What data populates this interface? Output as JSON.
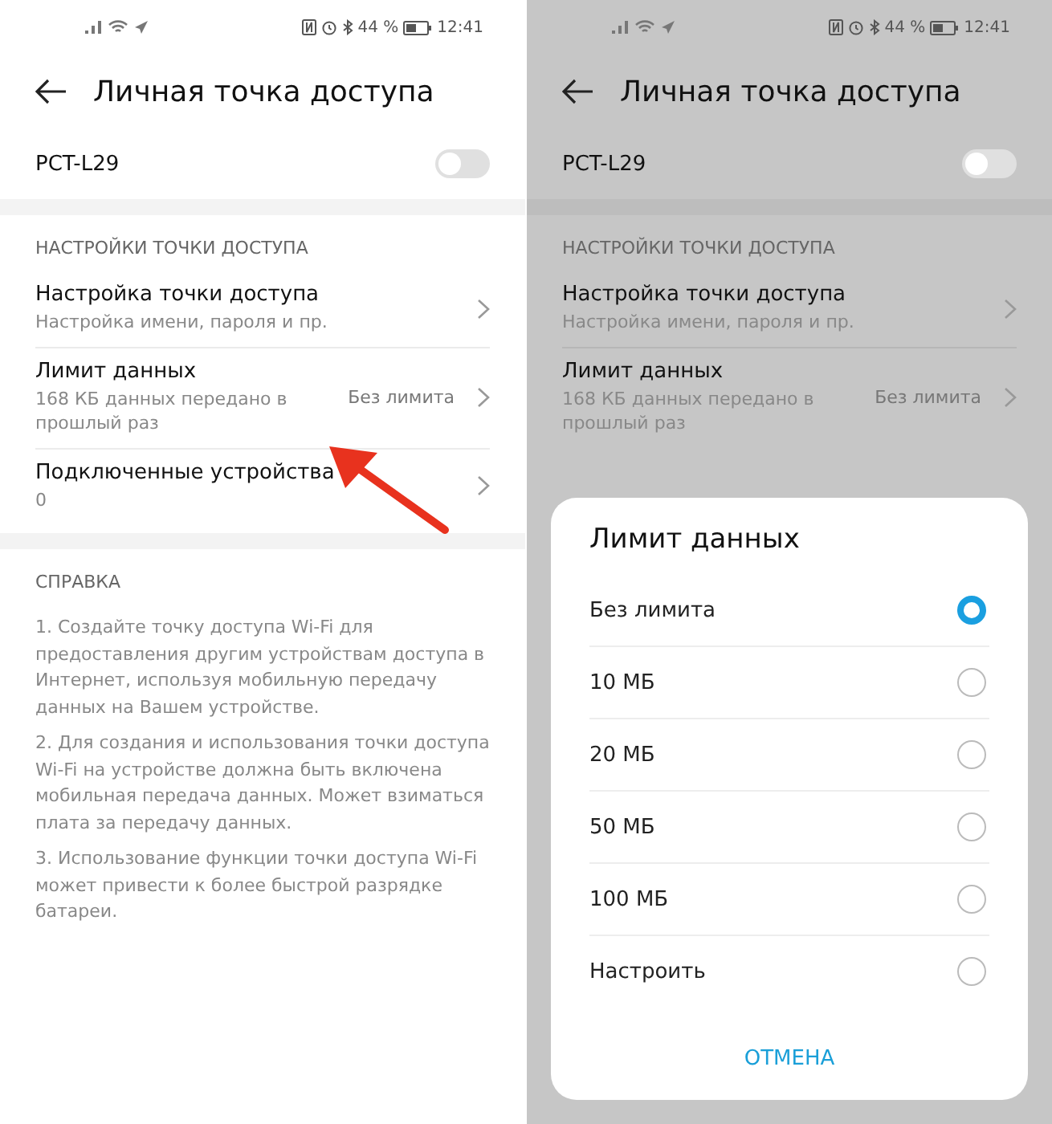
{
  "screens": [
    {
      "dimmed": false,
      "status": {
        "battery": "44 %",
        "time": "12:41"
      },
      "title": "Личная точка доступа",
      "hotspot": {
        "name": "PCT-L29",
        "on": false
      },
      "section": "НАСТРОЙКИ ТОЧКИ ДОСТУПА",
      "items": [
        {
          "title": "Настройка точки доступа",
          "subtitle": "Настройка имени, пароля и пр."
        },
        {
          "title": "Лимит данных",
          "subtitle": "168 КБ данных передано в прошлый раз",
          "value": "Без лимита"
        },
        {
          "title": "Подключенные устройства",
          "subtitle": "0"
        }
      ],
      "help": {
        "title": "СПРАВКА",
        "paragraphs": [
          "1. Создайте точку доступа Wi-Fi для предоставления другим устройствам доступа в Интернет, используя мобильную передачу данных на Вашем устройстве.",
          "2. Для создания и использования точки доступа Wi-Fi на устройстве должна быть включена мобильная передача данных. Может взиматься плата за передачу данных.",
          "3. Использование функции точки доступа Wi-Fi может привести к более быстрой разрядке батареи."
        ]
      },
      "arrow": true
    },
    {
      "dimmed": true,
      "status": {
        "battery": "44 %",
        "time": "12:41"
      },
      "title": "Личная точка доступа",
      "hotspot": {
        "name": "PCT-L29",
        "on": false
      },
      "section": "НАСТРОЙКИ ТОЧКИ ДОСТУПА",
      "items": [
        {
          "title": "Настройка точки доступа",
          "subtitle": "Настройка имени, пароля и пр."
        },
        {
          "title": "Лимит данных",
          "subtitle": "168 КБ данных передано в прошлый раз",
          "value": "Без лимита"
        }
      ],
      "dialog": {
        "title": "Лимит данных",
        "options": [
          {
            "label": "Без лимита",
            "selected": true
          },
          {
            "label": "10 МБ",
            "selected": false
          },
          {
            "label": "20 МБ",
            "selected": false
          },
          {
            "label": "50 МБ",
            "selected": false
          },
          {
            "label": "100 МБ",
            "selected": false
          },
          {
            "label": "Настроить",
            "selected": false
          }
        ],
        "cancel": "ОТМЕНА"
      }
    }
  ]
}
